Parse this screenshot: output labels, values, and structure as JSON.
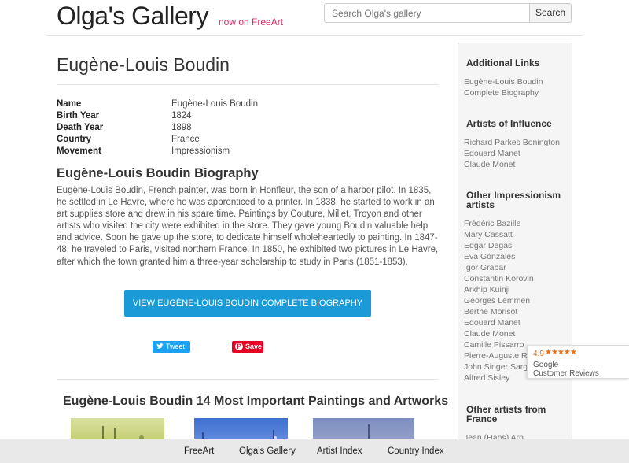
{
  "header": {
    "brand": "Olga's Gallery",
    "brand_sub": "now on FreeArt",
    "search_placeholder": "Search Olga's gallery",
    "search_button": "Search"
  },
  "main": {
    "title": "Eugène-Louis Boudin",
    "facts": [
      {
        "key": "Name",
        "value": "Eugène-Louis Boudin"
      },
      {
        "key": "Birth Year",
        "value": "1824"
      },
      {
        "key": "Death Year",
        "value": "1898"
      },
      {
        "key": "Country",
        "value": "France"
      },
      {
        "key": "Movement",
        "value": "Impressionism"
      }
    ],
    "bio_title": "Eugène-Louis Boudin Biography",
    "bio_text": "Eugène-Louis Boudin, French painter, was born in Honfleur, the son of a harbor pilot. In 1835, he settled in Le Havre, where he was apprenticed to a printer. In 1838, he started to work in an art supplies store and drew in his spare time. Paintings by Couture, Millet, Troyon and other artists who visited the city were exhibited in the store. They gave young Boudin valuable help and advice. Soon he gave up the store, to dedicate himself wholeheartedly to painting. In 1847-48, he traveled to Paris, visited northern France. In 1850, he exhibited two pictures in Le Havre, after which the town granted him a three-year scholarship to study in Paris (1851-1853).",
    "cta": "VIEW EUGÈNE-LOUIS BOUDIN COMPLETE BIOGRAPHY",
    "tweet": "Tweet",
    "pin": "Save",
    "paintings_title": "Eugène-Louis Boudin 14 Most Important Paintings and Artworks"
  },
  "sidebar": {
    "additional_head": "Additional Links",
    "additional_links": [
      "Eugène-Louis Boudin",
      "Complete Biography"
    ],
    "influence_head": "Artists of Influence",
    "influence_links": [
      "Richard Parkes Bonington",
      "Edouard Manet",
      "Claude Monet"
    ],
    "other_impr_head_1": "Other Impressionism",
    "other_impr_head_2": "artists",
    "other_impr_links": [
      "Frédéric Bazille",
      "Mary Cassatt",
      "Edgar Degas",
      "Eva Gonzales",
      "Igor Grabar",
      "Constantin Korovin",
      "Arkhip Kuinji",
      "Georges Lemmen",
      "Berthe Morisot",
      "Edouard Manet",
      "Claude Monet",
      "Camille Pissarro",
      "Pierre-Auguste Renoir",
      "John Singer Sargent",
      "Alfred Sisley"
    ],
    "france_head_1": "Other artists from",
    "france_head_2": "France",
    "france_links": [
      "Jean (Hans) Arp"
    ]
  },
  "google_badge": {
    "score": "4.9",
    "stars": "★★★★★",
    "line1": "Google",
    "line2": "Customer Reviews"
  },
  "footer": {
    "links": [
      "FreeArt",
      "Olga's Gallery",
      "Artist Index",
      "Country Index"
    ]
  },
  "colors": {
    "accent_blue": "#1a9ad6",
    "brand_pink": "#d6336c",
    "twitter": "#1da1f2",
    "pinterest": "#e60023"
  }
}
